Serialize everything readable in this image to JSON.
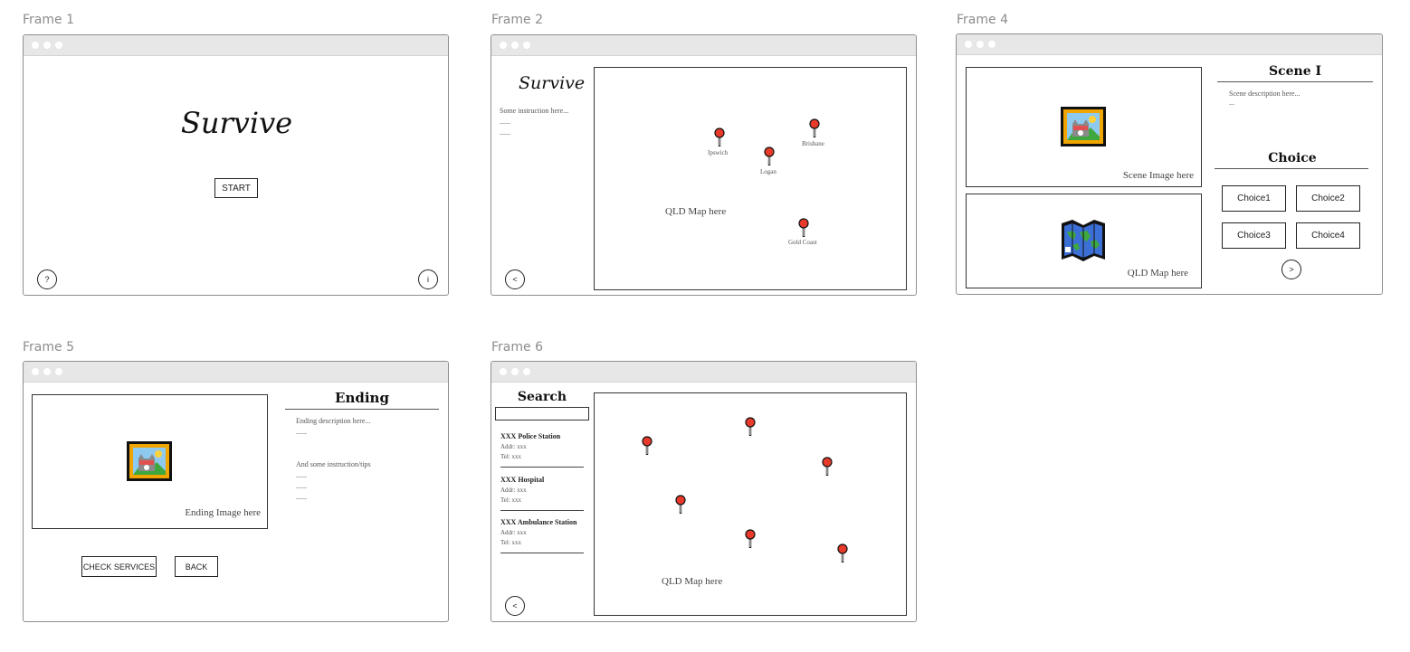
{
  "frames": {
    "f1": {
      "label": "Frame 1",
      "title": "Survive",
      "start": "START",
      "help": "?",
      "info": "i"
    },
    "f2": {
      "label": "Frame 2",
      "title": "Survive",
      "instr": "Some instruction here...",
      "dots1": "......",
      "dots2": "......",
      "map": "QLD Map here",
      "back": "<",
      "pins": [
        "Ipswich",
        "Brisbane",
        "Logan",
        "Gold Coast"
      ]
    },
    "f4": {
      "label": "Frame 4",
      "scene_title": "Scene I",
      "scene_desc": "Scene description here...",
      "scene_dots": "...",
      "scene_img": "Scene Image here",
      "map": "QLD Map here",
      "choice_title": "Choice",
      "choices": [
        "Choice1",
        "Choice2",
        "Choice3",
        "Choice4"
      ],
      "next": ">"
    },
    "f5": {
      "label": "Frame 5",
      "ending_title": "Ending",
      "ending_desc": "Ending description here...",
      "dots": "......",
      "tips": "And some instruction/tips",
      "tips_dots": [
        "......",
        "......",
        "......"
      ],
      "ending_img": "Ending Image here",
      "check": "CHECK SERVICES",
      "back": "BACK"
    },
    "f6": {
      "label": "Frame 6",
      "search_title": "Search",
      "search_value": "",
      "results": [
        {
          "name": "XXX Police Station",
          "addr": "Addr: xxx",
          "tel": "Tel: xxx"
        },
        {
          "name": "XXX Hospital",
          "addr": "Addr: xxx",
          "tel": "Tel: xxx"
        },
        {
          "name": "XXX Ambulance Station",
          "addr": "Addr: xxx",
          "tel": "Tel: xxx"
        }
      ],
      "map": "QLD Map here",
      "back": "<"
    }
  },
  "colors": {
    "pin": "#e83a2a",
    "frame_border": "#8e8e8e",
    "titlebar": "#e7e7e7",
    "picture_frame": "#f0a500"
  },
  "icons": [
    "picture-icon",
    "world-map-icon",
    "map-pin-icon"
  ]
}
